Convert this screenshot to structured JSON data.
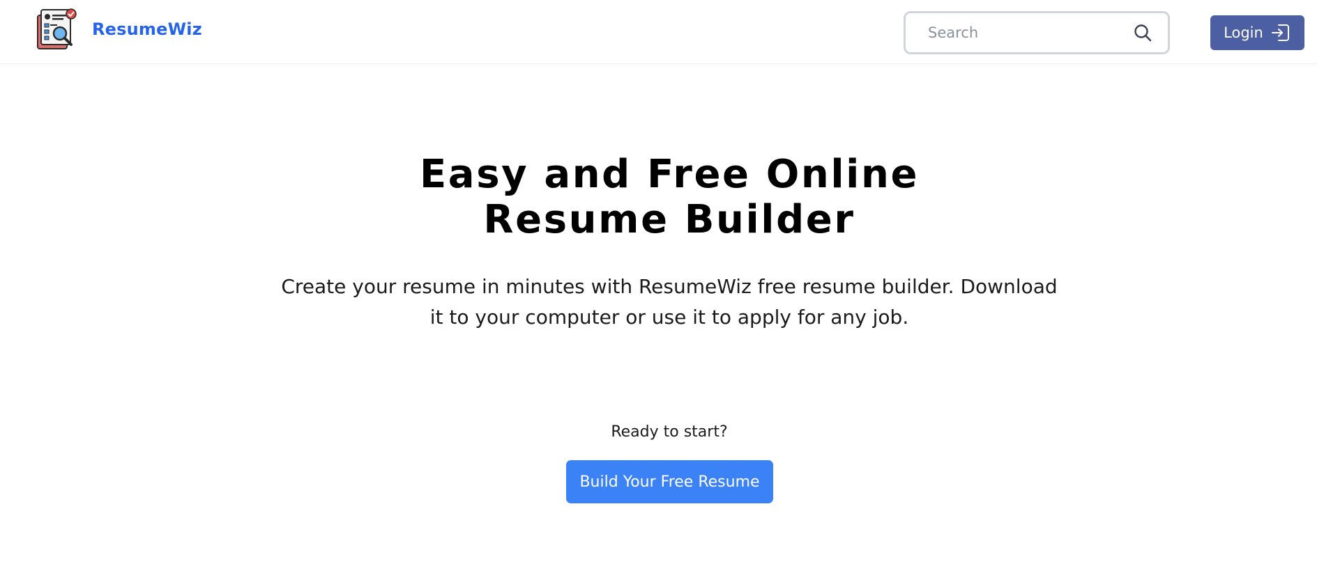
{
  "header": {
    "brand_name": "ResumeWiz",
    "brand_color": "#2563eb",
    "logo_icon": "resume-magnifier-logo",
    "search": {
      "placeholder": "Search",
      "value": "",
      "icon": "search-icon"
    },
    "login": {
      "label": "Login",
      "icon": "login-icon",
      "background": "#4c5fa3"
    }
  },
  "hero": {
    "title_lines": [
      "Easy and Free Online",
      "Resume Builder"
    ],
    "description_lines": [
      "Create your resume in minutes with ResumeWiz free resume builder. Download",
      "it to your computer or use it to apply for any job."
    ],
    "ready_text": "Ready to start?",
    "cta_label": "Build Your Free Resume",
    "cta_color": "#3b82f6"
  }
}
